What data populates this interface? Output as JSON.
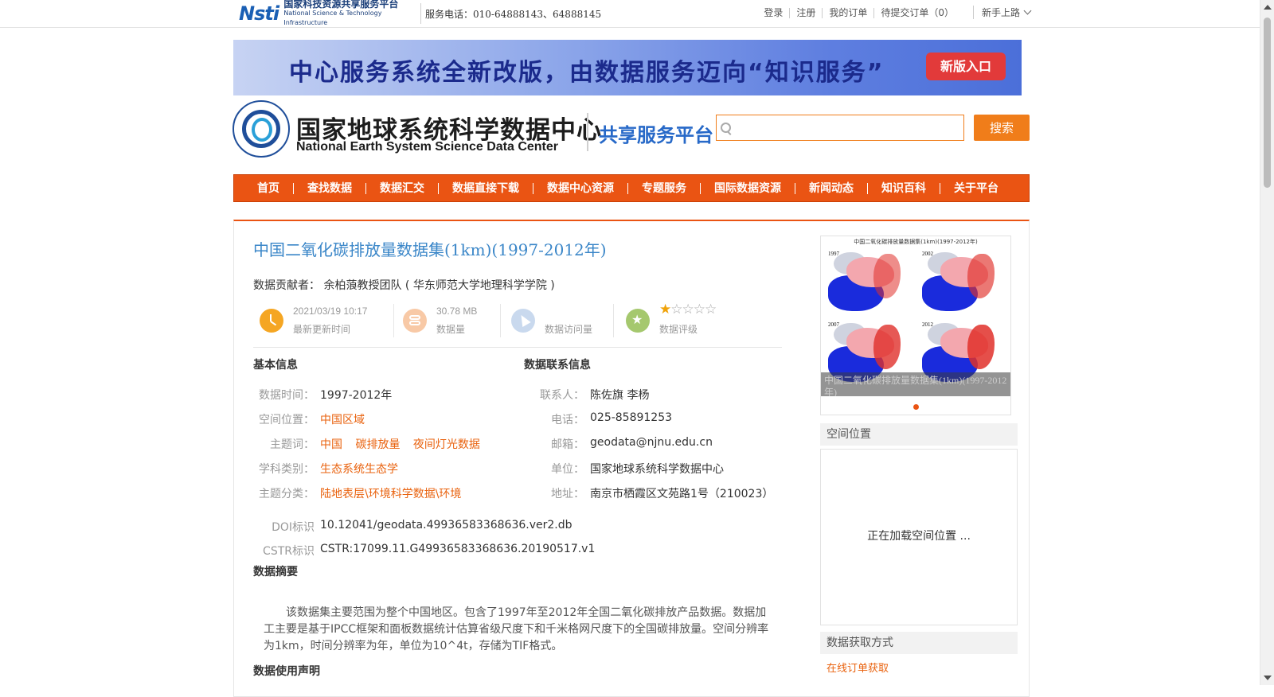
{
  "topbar": {
    "platform_cn": "国家科技资源共享服务平台",
    "platform_en": "National Science & Technology Infrastructure",
    "logo_mark": "Nsti",
    "service_phone": "服务电话：010-64888143、64888145",
    "links": [
      "登录",
      "注册",
      "我的订单",
      "待提交订单（0）"
    ],
    "newbie": "新手上路"
  },
  "banner": {
    "text": "中心服务系统全新改版，由数据服务迈向“知识服务”",
    "button": "新版入口"
  },
  "header": {
    "org_cn": "国家地球系统科学数据中心",
    "org_en": "National Earth System Science Data Center",
    "platform": "共享服务平台",
    "search_placeholder": "",
    "search_button": "搜索"
  },
  "nav": [
    "首页",
    "查找数据",
    "数据汇交",
    "数据直接下载",
    "数据中心资源",
    "专题服务",
    "国际数据资源",
    "新闻动态",
    "知识百科",
    "关于平台"
  ],
  "dataset": {
    "title": "中国二氧化碳排放量数据集(1km)(1997-2012年)",
    "contributor_label": "数据贡献者：",
    "contributor": "余柏蒗教授团队 ( 华东师范大学地理科学学院 )",
    "stats": {
      "updated_value": "2021/03/19 10:17",
      "updated_label": "最新更新时间",
      "size_value": "30.78 MB",
      "size_label": "数据量",
      "visits_value": "",
      "visits_label": "数据访问量",
      "rating_label": "数据评级",
      "rating": 1,
      "rating_max": 5
    },
    "basic": {
      "heading": "基本信息",
      "time_label": "数据时间：",
      "time": "1997-2012年",
      "location_label": "空间位置：",
      "location": "中国区域",
      "keywords_label": "主题词：",
      "keywords": [
        "中国",
        "碳排放量",
        "夜间灯光数据"
      ],
      "discipline_label": "学科类别：",
      "discipline": "生态系统生态学",
      "category_label": "主题分类：",
      "category": "陆地表层\\环境科学数据\\环境"
    },
    "contact": {
      "heading": "数据联系信息",
      "person_label": "联系人：",
      "person": "陈佐旗 李杨",
      "phone_label": "电话：",
      "phone": "025-85891253",
      "email_label": "邮箱：",
      "email": "geodata@njnu.edu.cn",
      "unit_label": "单位：",
      "unit": "国家地球系统科学数据中心",
      "address_label": "地址：",
      "address": "南京市栖霞区文苑路1号（210023）"
    },
    "doi_label": "DOI标识",
    "doi": "10.12041/geodata.49936583368636.ver2.db",
    "cstr_label": "CSTR标识",
    "cstr": "CSTR:17099.11.G49936583368636.20190517.v1",
    "abstract_heading": "数据摘要",
    "abstract": "该数据集主要范围为整个中国地区。包含了1997年至2012年全国二氧化碳排放产品数据。数据加工主要是基于IPCC框架和面板数据统计估算省级尺度下和千米格网尺度下的全国碳排放量。空间分辨率为1km，时间分辨率为年，单位为10^4t，存储为TIF格式。",
    "usage_heading": "数据使用声明"
  },
  "sidebar": {
    "thumb_title": "中国二氧化碳排放量数据集(1km)(1997-2012年)",
    "thumb_years": [
      "1997",
      "2002",
      "2007",
      "2012"
    ],
    "thumb_caption": "中国二氧化碳排放量数据集(1km)(1997-2012年)",
    "spatial_heading": "空间位置",
    "loading": "正在加载空间位置 ...",
    "access_heading": "数据获取方式",
    "order_link": "在线订单获取"
  },
  "colors": {
    "accent_orange": "#ea5413",
    "title_blue": "#3a86c8",
    "link_orange": "#e9620e"
  }
}
